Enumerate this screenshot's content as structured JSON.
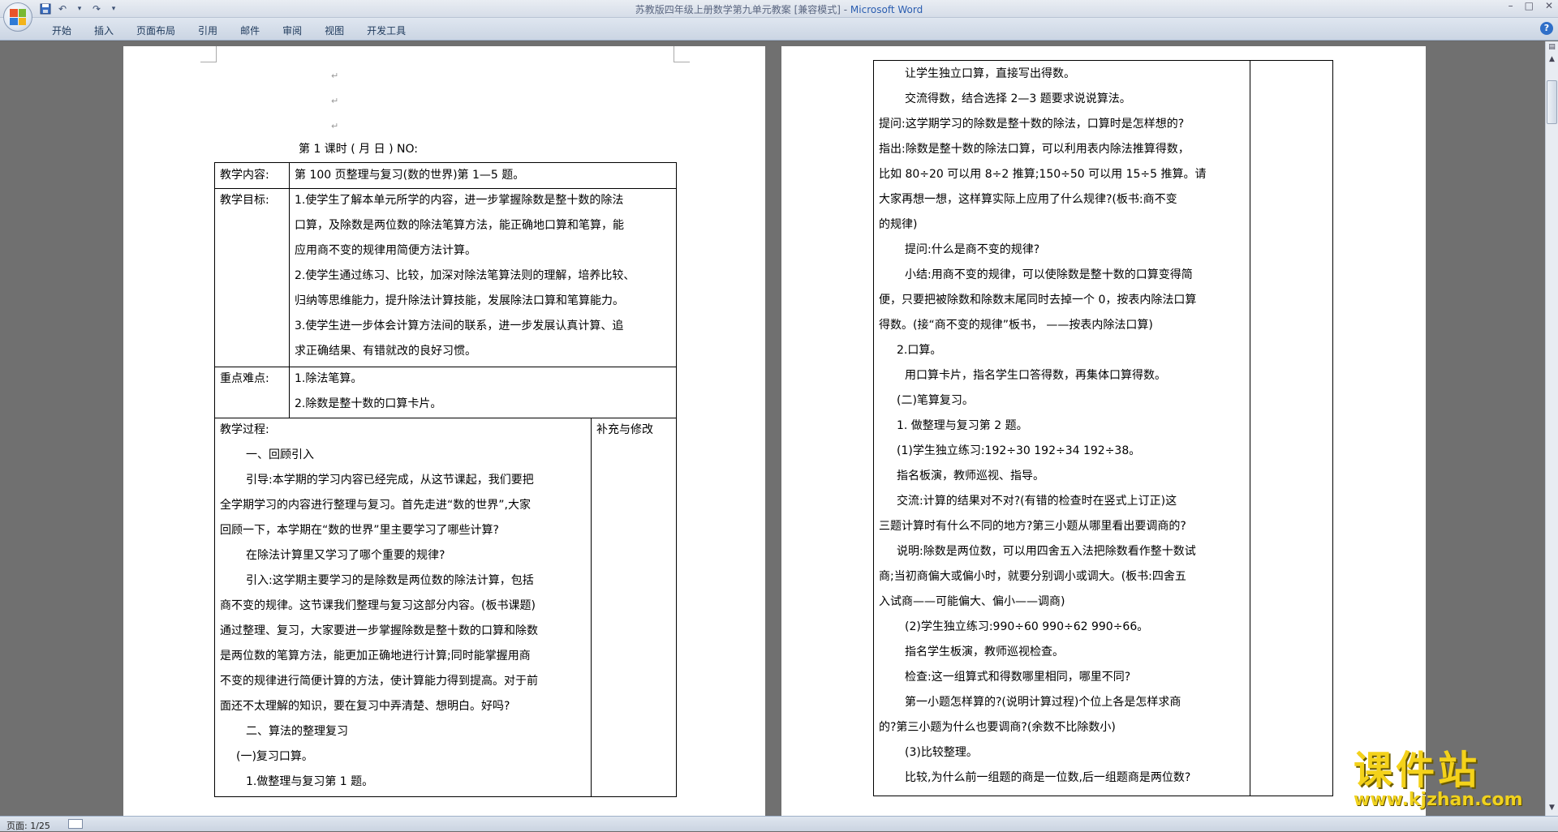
{
  "titlebar": {
    "doc_name": "苏教版四年级上册数学第九单元教案 [兼容模式] - ",
    "app_name": "Microsoft Word",
    "min": "–",
    "max": "□",
    "close": "✕"
  },
  "ribbon": {
    "tabs": [
      "开始",
      "插入",
      "页面布局",
      "引用",
      "邮件",
      "审阅",
      "视图",
      "开发工具"
    ],
    "help": "?"
  },
  "status": {
    "page": "页面: 1/25"
  },
  "page1": {
    "header": "第 1  课时   (   月   日 )             NO:",
    "rows": {
      "content_label": "教学内容:",
      "content_value": "第 100 页整理与复习(数的世界)第 1—5 题。",
      "goals_label": "教学目标:",
      "goals": [
        "1.使学生了解本单元所学的内容，进一步掌握除数是整十数的除法",
        "口算，及除数是两位数的除法笔算方法，能正确地口算和笔算，能",
        "应用商不变的规律用简便方法计算。",
        "2.使学生通过练习、比较，加深对除法笔算法则的理解，培养比较、",
        "归纳等思维能力，提升除法计算技能，发展除法口算和笔算能力。",
        "3.使学生进一步体会计算方法间的联系，进一步发展认真计算、追",
        "求正确结果、有错就改的良好习惯。"
      ],
      "key_label": "重点难点:",
      "key": [
        "1.除法笔算。",
        "2.除数是整十数的口算卡片。"
      ],
      "process_label": "教学过程:",
      "supplement_label": "补充与修改",
      "process": [
        "一、回顾引入",
        "引导:本学期的学习内容已经完成，从这节课起，我们要把",
        "全学期学习的内容进行整理与复习。首先走进“数的世界”,大家",
        "回顾一下，本学期在“数的世界”里主要学习了哪些计算?",
        "在除法计算里又学习了哪个重要的规律?",
        "引入:这学期主要学习的是除数是两位数的除法计算，包括",
        "商不变的规律。这节课我们整理与复习这部分内容。(板书课题)",
        "通过整理、复习，大家要进一步掌握除数是整十数的口算和除数",
        "是两位数的笔算方法，能更加正确地进行计算;同时能掌握用商",
        "不变的规律进行简便计算的方法，使计算能力得到提高。对于前",
        "面还不太理解的知识，要在复习中弄清楚、想明白。好吗?",
        "二、算法的整理复习",
        "(一)复习口算。",
        "1.做整理与复习第 1 题。"
      ]
    }
  },
  "page2": {
    "lines": [
      "让学生独立口算，直接写出得数。",
      "交流得数，结合选择 2—3 题要求说说算法。",
      "提问:这学期学习的除数是整十数的除法，口算时是怎样想的?",
      "指出:除数是整十数的除法口算，可以利用表内除法推算得数，",
      "比如 80÷20 可以用 8÷2 推算;150÷50 可以用 15÷5 推算。请",
      "大家再想一想，这样算实际上应用了什么规律?(板书:商不变",
      "的规律)",
      "提问:什么是商不变的规律?",
      "小结:用商不变的规律，可以使除数是整十数的口算变得简",
      "便，只要把被除数和除数末尾同时去掉一个 0，按表内除法口算",
      "得数。(接“商不变的规律”板书， ——按表内除法口算)",
      "2.口算。",
      "用口算卡片，指名学生口答得数，再集体口算得数。",
      "(二)笔算复习。",
      "1. 做整理与复习第 2 题。",
      "(1)学生独立练习:192÷30      192÷34      192÷38。",
      "指名板演，教师巡视、指导。",
      "交流:计算的结果对不对?(有错的检查时在竖式上订正)这",
      "三题计算时有什么不同的地方?第三小题从哪里看出要调商的?",
      "说明:除数是两位数，可以用四舍五入法把除数看作整十数试",
      "商;当初商偏大或偏小时，就要分别调小或调大。(板书:四舍五",
      "入试商——可能偏大、偏小——调商)",
      "(2)学生独立练习:990÷60       990÷62          990÷66。",
      "指名学生板演，教师巡视检查。",
      "检查:这一组算式和得数哪里相同，哪里不同?",
      "第一小题怎样算的?(说明计算过程)个位上各是怎样求商",
      "的?第三小题为什么也要调商?(余数不比除数小)",
      "(3)比较整理。",
      "比较,为什么前一组题的商是一位数,后一组题商是两位数?"
    ]
  },
  "watermark": {
    "cn": "课件站",
    "url": "www.kjzhan.com"
  },
  "colors": {
    "titlebar": "#d6dde8",
    "ribbon": "#cbd5e3",
    "workspace": "#707070",
    "accent": "#2a5db0",
    "watermark": "#f4d21a"
  }
}
